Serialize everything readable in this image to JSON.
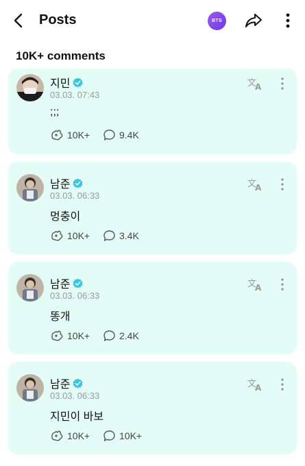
{
  "header": {
    "title": "Posts",
    "badge_text": "BTS"
  },
  "comments_count": "10K+ comments",
  "comments": [
    {
      "author": "지민",
      "date": "03.03. 07:43",
      "text": ";;;",
      "likes": "10K+",
      "replies": "9.4K",
      "avatar_icon": "profile-photo-masked"
    },
    {
      "author": "남준",
      "date": "03.03. 06:33",
      "text": "멍충이",
      "likes": "10K+",
      "replies": "3.4K",
      "avatar_icon": "profile-photo"
    },
    {
      "author": "남준",
      "date": "03.03. 06:33",
      "text": "똥개",
      "likes": "10K+",
      "replies": "2.4K",
      "avatar_icon": "profile-photo"
    },
    {
      "author": "남준",
      "date": "03.03. 06:33",
      "text": "지민이 바보",
      "likes": "10K+",
      "replies": "10K+",
      "avatar_icon": "profile-photo"
    }
  ],
  "colors": {
    "card_bg": "#e4fcf6",
    "verified": "#35c6e8",
    "badge": "#7c45ea"
  }
}
